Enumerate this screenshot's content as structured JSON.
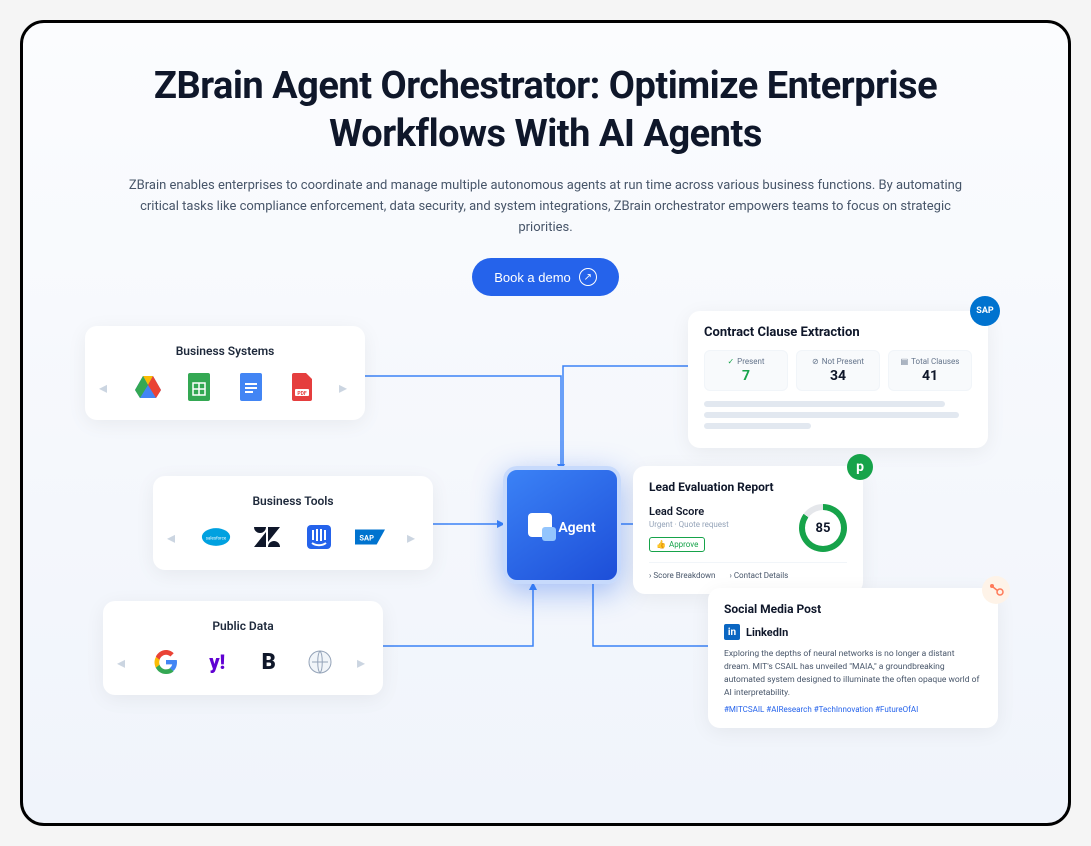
{
  "hero": {
    "title": "ZBrain Agent Orchestrator: Optimize Enterprise Workflows With AI Agents",
    "description": "ZBrain enables enterprises to coordinate and manage multiple autonomous agents at run time across various business functions. By automating critical tasks like compliance enforcement, data security, and system integrations, ZBrain orchestrator empowers teams to focus on strategic priorities.",
    "cta_label": "Book a demo"
  },
  "agent": {
    "label": "Agent"
  },
  "left_cards": {
    "business_systems": {
      "title": "Business Systems",
      "icons": [
        "gdrive",
        "gsheets",
        "gdocs",
        "pdf"
      ]
    },
    "business_tools": {
      "title": "Business Tools",
      "icons": [
        "salesforce",
        "zendesk",
        "intercom",
        "sap"
      ]
    },
    "public_data": {
      "title": "Public Data",
      "icons": [
        "google",
        "yahoo",
        "bold",
        "wikipedia"
      ]
    }
  },
  "contract": {
    "title": "Contract Clause Extraction",
    "badge": "SAP",
    "metrics": [
      {
        "label": "Present",
        "value": "7",
        "color": "green"
      },
      {
        "label": "Not Present",
        "value": "34",
        "color": "dark"
      },
      {
        "label": "Total Clauses",
        "value": "41",
        "color": "dark"
      }
    ]
  },
  "lead": {
    "title": "Lead Evaluation Report",
    "score_label": "Lead Score",
    "urgent": "Urgent · Quote request",
    "approve": "Approve",
    "score": "85",
    "links": [
      "Score Breakdown",
      "Contact Details"
    ],
    "badge": "p"
  },
  "social": {
    "title": "Social Media Post",
    "platform": "LinkedIn",
    "body": "Exploring the depths of neural networks is no longer a distant dream. MIT's CSAIL has unveiled \"MAIA,\" a groundbreaking automated system designed to illuminate the often opaque world of AI interpretability.",
    "tags": "#MITCSAIL #AIResearch #TechInnovation #FutureOfAI"
  }
}
